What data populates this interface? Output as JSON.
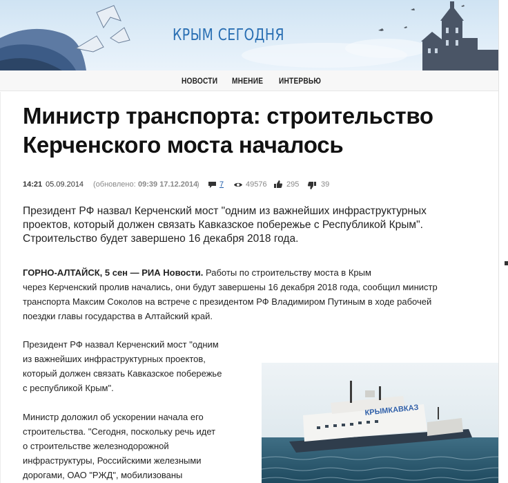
{
  "site": {
    "title": "КРЫМ СЕГОДНЯ"
  },
  "nav": {
    "items": [
      "НОВОСТИ",
      "МНЕНИЕ",
      "ИНТЕРВЬЮ"
    ]
  },
  "article": {
    "headline_line1": "Министр транспорта: строительство",
    "headline_line2": "Керченского моста началось",
    "meta": {
      "time": "14:21",
      "date": "05.09.2014",
      "updated_prefix": "(обновлено:",
      "updated_value": "09:39 17.12.2014",
      "updated_suffix": ")",
      "comments": "7",
      "views": "49576",
      "likes": "295",
      "dislikes": "39"
    },
    "lead": "Президент РФ назвал Керченский мост \"одним из важнейших инфраструктурных проектов, который должен связать Кавказское побережье с Республикой Крым\". Строительство будет завершено 16 декабря 2018 года.",
    "p1_dateline": "ГОРНО-АЛТАЙСК, 5 сен — РИА Новости.",
    "p1_line1": "Работы по строительству моста в Крым",
    "p1_line2": "через Керченский пролив начались, они будут завершены 16 декабря 2018 года, сообщил министр",
    "p1_line3": "транспорта Максим Соколов на встрече с президентом РФ Владимиром Путиным в ходе рабочей",
    "p1_line4": "поездки главы государства в Алтайский край.",
    "p2_line1": "Президент РФ назвал Керченский мост \"одним",
    "p2_line2": "из важнейших инфраструктурных проектов,",
    "p2_line3": "который должен связать Кавказское побережье",
    "p2_line4": "с республикой Крым\".",
    "p3_line1": "Министр доложил об ускорении начала его",
    "p3_line2": "строительства. \"Сегодня, поскольку речь идет",
    "p3_line3": "о строительстве железнодорожной",
    "p3_line4": "инфраструктуры, Российскими железными",
    "p3_line5": "дорогами, ОАО \"РЖД\", мобилизованы",
    "photo_ship_text": "КРЫМКАВКАЗ"
  },
  "icons": {
    "comments": "comment-icon",
    "views": "eye-icon",
    "likes": "thumbs-up-icon",
    "dislikes": "thumbs-down-icon"
  },
  "colors": {
    "brand": "#2a6fb3",
    "link": "#1e5ba8"
  }
}
